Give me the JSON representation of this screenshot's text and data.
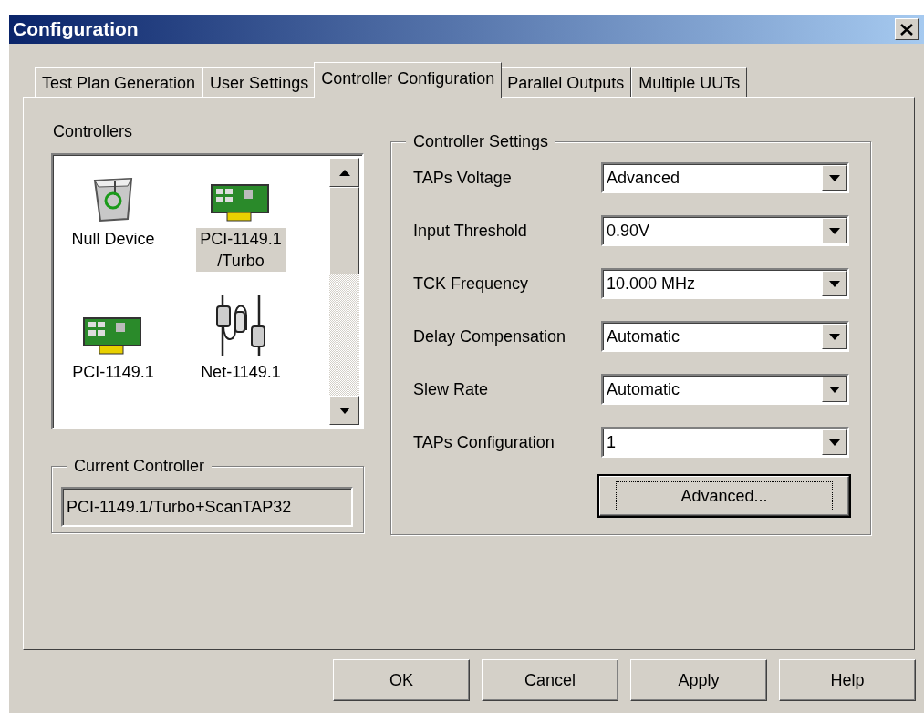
{
  "window": {
    "title": "Configuration"
  },
  "tabs": [
    {
      "label": "Test Plan Generation",
      "selected": false
    },
    {
      "label": "User Settings",
      "selected": false
    },
    {
      "label": "Controller Configuration",
      "selected": true
    },
    {
      "label": "Parallel Outputs",
      "selected": false
    },
    {
      "label": "Multiple UUTs",
      "selected": false
    }
  ],
  "controllers": {
    "label": "Controllers",
    "items": [
      {
        "name": "Null Device",
        "kind": "trash",
        "selected": false
      },
      {
        "name": "PCI-1149.1\n/Turbo",
        "kind": "card",
        "selected": true
      },
      {
        "name": "PCI-1149.1",
        "kind": "card",
        "selected": false
      },
      {
        "name": "Net-1149.1",
        "kind": "cable",
        "selected": false
      }
    ]
  },
  "current_controller": {
    "label": "Current Controller",
    "value": "PCI-1149.1/Turbo+ScanTAP32"
  },
  "settings": {
    "label": "Controller Settings",
    "rows": [
      {
        "label": "TAPs Voltage",
        "value": "Advanced"
      },
      {
        "label": "Input Threshold",
        "value": "0.90V"
      },
      {
        "label": "TCK Frequency",
        "value": "10.000 MHz"
      },
      {
        "label": "Delay Compensation",
        "value": "Automatic"
      },
      {
        "label": "Slew Rate",
        "value": "Automatic"
      },
      {
        "label": "TAPs Configuration",
        "value": "1"
      }
    ],
    "advanced_button": {
      "label": "Advanced...",
      "focused": true
    }
  },
  "buttons": [
    {
      "label": "OK"
    },
    {
      "label": "Cancel"
    },
    {
      "parts": [
        {
          "text": "A",
          "underlined": true
        },
        {
          "text": "pply",
          "underlined": false
        }
      ]
    },
    {
      "label": "Help"
    }
  ]
}
